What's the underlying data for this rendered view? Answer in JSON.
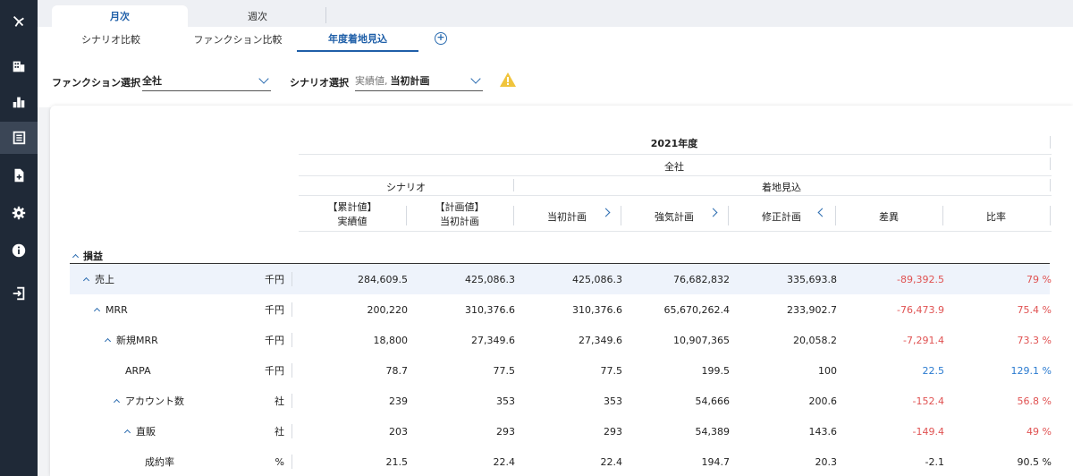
{
  "sidebar": {
    "items": [
      {
        "icon": "logo-icon"
      },
      {
        "icon": "building-icon"
      },
      {
        "icon": "bar-chart-icon"
      },
      {
        "icon": "report-icon",
        "active": true
      },
      {
        "icon": "add-document-icon"
      },
      {
        "icon": "gear-icon"
      },
      {
        "icon": "info-icon"
      },
      {
        "icon": "logout-icon"
      }
    ]
  },
  "top_tabs": [
    {
      "label": "月次",
      "active": true
    },
    {
      "label": "週次",
      "active": false
    }
  ],
  "sub_tabs": [
    {
      "label": "シナリオ比較"
    },
    {
      "label": "ファンクション比較"
    },
    {
      "label": "年度着地見込",
      "active": true
    }
  ],
  "filters": {
    "function_label": "ファンクション選択",
    "function_value": "全社",
    "scenario_label": "シナリオ選択",
    "scenario_prefix": "実績値,",
    "scenario_value": "当初計画"
  },
  "table": {
    "year_header": "2021年度",
    "company_header": "全社",
    "group_scenario": "シナリオ",
    "group_forecast": "着地見込",
    "columns": [
      {
        "line1": "【累計値】",
        "line2": "実績値"
      },
      {
        "line1": "【計画値】",
        "line2": "当初計画"
      },
      {
        "line1": "当初計画"
      },
      {
        "line1": "強気計画"
      },
      {
        "line1": "修正計画"
      },
      {
        "line1": "差異"
      },
      {
        "line1": "比率"
      }
    ],
    "section": "損益",
    "rows": [
      {
        "name": "売上",
        "unit": "千円",
        "values": [
          "284,609.5",
          "425,086.3",
          "425,086.3",
          "76,682,832",
          "335,693.8",
          "-89,392.5",
          "79 %"
        ]
      },
      {
        "name": "MRR",
        "unit": "千円",
        "values": [
          "200,220",
          "310,376.6",
          "310,376.6",
          "65,670,262.4",
          "233,902.7",
          "-76,473.9",
          "75.4 %"
        ]
      },
      {
        "name": "新規MRR",
        "unit": "千円",
        "values": [
          "18,800",
          "27,349.6",
          "27,349.6",
          "10,907,365",
          "20,058.2",
          "-7,291.4",
          "73.3 %"
        ]
      },
      {
        "name": "ARPA",
        "unit": "千円",
        "values": [
          "78.7",
          "77.5",
          "77.5",
          "199.5",
          "100",
          "22.5",
          "129.1 %"
        ]
      },
      {
        "name": "アカウント数",
        "unit": "社",
        "values": [
          "239",
          "353",
          "353",
          "54,666",
          "200.6",
          "-152.4",
          "56.8 %"
        ]
      },
      {
        "name": "直販",
        "unit": "社",
        "values": [
          "203",
          "293",
          "293",
          "54,389",
          "143.6",
          "-149.4",
          "49 %"
        ]
      },
      {
        "name": "成約率",
        "unit": "%",
        "values": [
          "21.5",
          "22.4",
          "22.4",
          "194.7",
          "20.3",
          "-2.1",
          "90.5 %"
        ]
      }
    ]
  }
}
